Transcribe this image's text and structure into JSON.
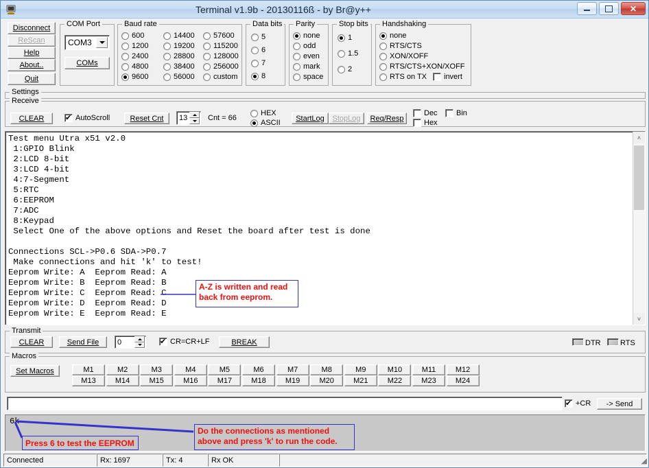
{
  "window": {
    "title": "Terminal v1.9b - 20130116ß - by Br@y++",
    "icon": "terminal-icon",
    "minimize": "–",
    "maximize": "□",
    "close": "✕"
  },
  "left_buttons": [
    {
      "label": "Disconnect",
      "name": "disconnect-button",
      "disabled": false
    },
    {
      "label": "ReScan",
      "name": "rescan-button",
      "disabled": true
    },
    {
      "label": "Help",
      "name": "help-button",
      "disabled": false
    },
    {
      "label": "About..",
      "name": "about-button",
      "disabled": false
    },
    {
      "label": "Quit",
      "name": "quit-button",
      "disabled": false
    }
  ],
  "com_port": {
    "title": "COM Port",
    "selected": "COM3",
    "coms_label": "COMs"
  },
  "baud_rate": {
    "title": "Baud rate",
    "selected": "9600",
    "col1": [
      "600",
      "1200",
      "2400",
      "4800",
      "9600"
    ],
    "col2": [
      "14400",
      "19200",
      "28800",
      "38400",
      "56000"
    ],
    "col3": [
      "57600",
      "115200",
      "128000",
      "256000",
      "custom"
    ]
  },
  "data_bits": {
    "title": "Data bits",
    "selected": "8",
    "options": [
      "5",
      "6",
      "7",
      "8"
    ]
  },
  "parity": {
    "title": "Parity",
    "selected": "none",
    "options": [
      "none",
      "odd",
      "even",
      "mark",
      "space"
    ]
  },
  "stop_bits": {
    "title": "Stop bits",
    "selected": "1",
    "options": [
      "1",
      "1.5",
      "2"
    ]
  },
  "handshaking": {
    "title": "Handshaking",
    "selected": "none",
    "options": [
      "none",
      "RTS/CTS",
      "XON/XOFF",
      "RTS/CTS+XON/XOFF",
      "RTS on TX"
    ],
    "invert_label": "invert",
    "invert_checked": false
  },
  "settings": {
    "title": "Settings"
  },
  "receive": {
    "title": "Receive",
    "clear_label": "CLEAR",
    "autoscroll_label": "AutoScroll",
    "autoscroll_checked": true,
    "reset_cnt_label": "Reset Cnt",
    "cnt_field_value": "13",
    "cnt_label": "Cnt = ",
    "cnt_value": "66",
    "hex_label": "HEX",
    "ascii_label": "ASCII",
    "mode_selected": "ASCII",
    "startlog_label": "StartLog",
    "stoplog_label": "StopLog",
    "reqresp_label": "Req/Resp",
    "dec_label": "Dec",
    "hex_chk_label": "Hex",
    "bin_label": "Bin",
    "dec_checked": false,
    "hex_chk_checked": false,
    "bin_checked": false
  },
  "terminal": {
    "lines": [
      "Test menu Utra x51 v2.0",
      " 1:GPIO Blink",
      " 2:LCD 8-bit",
      " 3:LCD 4-bit",
      " 4:7-Segment",
      " 5:RTC",
      " 6:EEPROM",
      " 7:ADC",
      " 8:Keypad",
      " Select One of the above options and Reset the board after test is done",
      "",
      "Connections SCL->P0.6 SDA->P0.7",
      " Make connections and hit 'k' to test!",
      "Eeprom Write: A  Eeprom Read: A",
      "Eeprom Write: B  Eeprom Read: B",
      "Eeprom Write: C  Eeprom Read: C",
      "Eeprom Write: D  Eeprom Read: D",
      "Eeprom Write: E  Eeprom Read: E"
    ],
    "scroll_up": "˄",
    "scroll_down": "˅"
  },
  "annotations": {
    "eeprom_note": "A-Z is written and read\nback from eeprom.",
    "press6_note": "Press 6 to test the EEPROM",
    "connections_note": "Do the connections as mentioned\nabove and press 'k' to run the code.",
    "echo_text": "6k",
    "box_color": "#3333cc",
    "text_color": "#ee1111",
    "highlight_color": "#dd2222"
  },
  "transmit": {
    "title": "Transmit",
    "clear_label": "CLEAR",
    "send_file_label": "Send File",
    "delay_value": "0",
    "crlf_label": "CR=CR+LF",
    "crlf_checked": true,
    "break_label": "BREAK",
    "dtr_label": "DTR",
    "rts_label": "RTS"
  },
  "macros": {
    "title": "Macros",
    "set_macros_label": "Set Macros",
    "row1": [
      "M1",
      "M2",
      "M3",
      "M4",
      "M5",
      "M6",
      "M7",
      "M8",
      "M9",
      "M10",
      "M11",
      "M12"
    ],
    "row2": [
      "M13",
      "M14",
      "M15",
      "M16",
      "M17",
      "M18",
      "M19",
      "M20",
      "M21",
      "M22",
      "M23",
      "M24"
    ]
  },
  "send_bar": {
    "input_value": "",
    "cr_label": "+CR",
    "cr_checked": true,
    "send_label": "-> Send"
  },
  "statusbar": {
    "connected": "Connected",
    "rx": "Rx: 1697",
    "tx": "Tx: 4",
    "rx_ok": "Rx OK",
    "extra": ""
  }
}
